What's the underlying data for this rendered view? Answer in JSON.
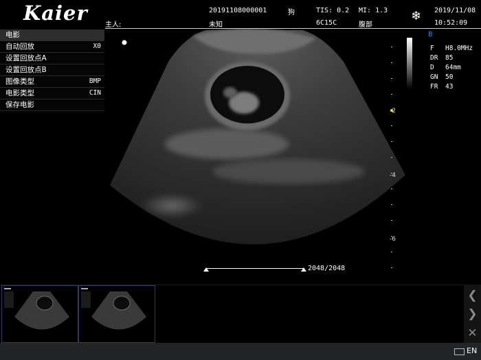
{
  "header": {
    "brand": "Kaier",
    "exam_id": "20191108000001",
    "species": "狗",
    "tis": "TIS: 0.2",
    "mi": "MI: 1.3",
    "date": "2019/11/08",
    "owner_label": "主人:",
    "owner_value": "未知",
    "probe": "6C15C",
    "region": "腹部",
    "time": "10:52:09"
  },
  "menu": {
    "title": "电影",
    "items": [
      {
        "label": "自动回放",
        "value": "X0"
      },
      {
        "label": "设置回放点A",
        "value": ""
      },
      {
        "label": "设置回放点B",
        "value": ""
      },
      {
        "label": "图像类型",
        "value": "BMP"
      },
      {
        "label": "电影类型",
        "value": "CIN"
      },
      {
        "label": "保存电影",
        "value": ""
      }
    ]
  },
  "params": {
    "mode": "B",
    "rows": [
      {
        "key": "F",
        "value": "H8.0MHz"
      },
      {
        "key": "DR",
        "value": "85"
      },
      {
        "key": "D",
        "value": "64mm"
      },
      {
        "key": "GN",
        "value": "50"
      },
      {
        "key": "FR",
        "value": "43"
      }
    ]
  },
  "depth_labels": [
    "-2",
    "-4",
    "-6"
  ],
  "cine": {
    "frames": "2048/2048"
  },
  "thumbnail_count": 2,
  "status": {
    "language": "EN"
  },
  "colors": {
    "mode_label": "#3a8ad6",
    "thumb_border": "#2f3b66",
    "status_bg": "#222428"
  }
}
